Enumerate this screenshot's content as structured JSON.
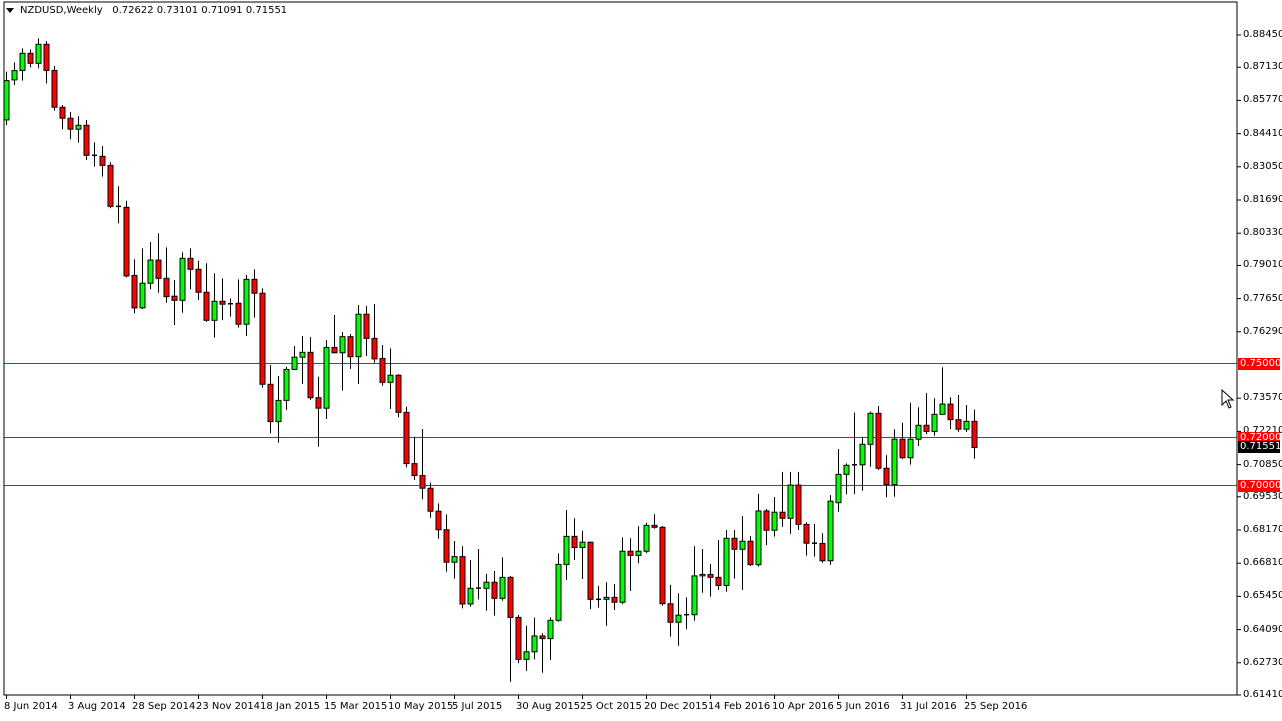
{
  "header": {
    "symbol": "NZDUSD,Weekly",
    "ohlc": "0.72622 0.73101 0.71091 0.71551"
  },
  "colors": {
    "bull": "#00ff00",
    "bear": "#ff0000",
    "level_line": "#ff0000",
    "current_badge": "#000000",
    "outline": "#000000"
  },
  "chart_data": {
    "type": "candlestick",
    "title": "NZDUSD,Weekly",
    "ylim": [
      0.6141,
      0.8845
    ],
    "y_ticks": [
      "0.88450",
      "0.87130",
      "0.85770",
      "0.84410",
      "0.83050",
      "0.81690",
      "0.80330",
      "0.79010",
      "0.77650",
      "0.76290",
      "0.73570",
      "0.72210",
      "0.70850",
      "0.69530",
      "0.68170",
      "0.66810",
      "0.65450",
      "0.64090",
      "0.62730",
      "0.61410"
    ],
    "x_labels": [
      "8 Jun 2014",
      "3 Aug 2014",
      "28 Sep 2014",
      "23 Nov 2014",
      "18 Jan 2015",
      "15 Mar 2015",
      "10 May 2015",
      "5 Jul 2015",
      "30 Aug 2015",
      "25 Oct 2015",
      "20 Dec 2015",
      "14 Feb 2016",
      "10 Apr 2016",
      "5 Jun 2016",
      "31 Jul 2016",
      "25 Sep 2016"
    ],
    "x_label_every": 8,
    "levels": [
      {
        "price": 0.75,
        "label": "0.75000"
      },
      {
        "price": 0.72,
        "label": "0.72000"
      },
      {
        "price": 0.7,
        "label": "0.70000"
      }
    ],
    "current": {
      "price": 0.71551,
      "label": "0.71551"
    },
    "candles_ohlc": [
      [
        0.8497,
        0.8695,
        0.8476,
        0.8658
      ],
      [
        0.8661,
        0.8733,
        0.864,
        0.8699
      ],
      [
        0.87,
        0.879,
        0.8658,
        0.877
      ],
      [
        0.877,
        0.8786,
        0.8713,
        0.8729
      ],
      [
        0.8729,
        0.8831,
        0.8709,
        0.8807
      ],
      [
        0.8807,
        0.882,
        0.8647,
        0.87
      ],
      [
        0.87,
        0.8718,
        0.8535,
        0.8549
      ],
      [
        0.8549,
        0.8558,
        0.8459,
        0.8504
      ],
      [
        0.8504,
        0.853,
        0.8418,
        0.8459
      ],
      [
        0.8459,
        0.8513,
        0.8404,
        0.8475
      ],
      [
        0.8475,
        0.8497,
        0.8333,
        0.8352
      ],
      [
        0.8352,
        0.8405,
        0.8305,
        0.8349
      ],
      [
        0.8348,
        0.839,
        0.8265,
        0.8311
      ],
      [
        0.8311,
        0.8324,
        0.8135,
        0.8143
      ],
      [
        0.8143,
        0.8226,
        0.8074,
        0.8142
      ],
      [
        0.8139,
        0.8166,
        0.7852,
        0.7858
      ],
      [
        0.786,
        0.7926,
        0.7705,
        0.7727
      ],
      [
        0.7727,
        0.7971,
        0.7722,
        0.7828
      ],
      [
        0.7828,
        0.7997,
        0.7803,
        0.7923
      ],
      [
        0.7923,
        0.8033,
        0.7789,
        0.7848
      ],
      [
        0.7848,
        0.7975,
        0.7748,
        0.7773
      ],
      [
        0.7775,
        0.7841,
        0.7657,
        0.7758
      ],
      [
        0.7758,
        0.7955,
        0.7707,
        0.793
      ],
      [
        0.793,
        0.7971,
        0.7803,
        0.7885
      ],
      [
        0.7885,
        0.792,
        0.7759,
        0.7791
      ],
      [
        0.7791,
        0.791,
        0.767,
        0.7676
      ],
      [
        0.7676,
        0.7869,
        0.7605,
        0.7754
      ],
      [
        0.7754,
        0.7848,
        0.7677,
        0.7742
      ],
      [
        0.7743,
        0.7766,
        0.7691,
        0.7744
      ],
      [
        0.7746,
        0.7844,
        0.7646,
        0.766
      ],
      [
        0.766,
        0.7862,
        0.7612,
        0.7844
      ],
      [
        0.7844,
        0.7885,
        0.7687,
        0.7787
      ],
      [
        0.7787,
        0.7807,
        0.74,
        0.7414
      ],
      [
        0.7414,
        0.7493,
        0.7213,
        0.7261
      ],
      [
        0.7261,
        0.7448,
        0.7175,
        0.7348
      ],
      [
        0.7348,
        0.7486,
        0.7309,
        0.7475
      ],
      [
        0.7475,
        0.7571,
        0.7473,
        0.7525
      ],
      [
        0.7525,
        0.7612,
        0.7415,
        0.7545
      ],
      [
        0.7545,
        0.7607,
        0.735,
        0.7359
      ],
      [
        0.7359,
        0.7445,
        0.7158,
        0.7316
      ],
      [
        0.7316,
        0.7595,
        0.7272,
        0.7565
      ],
      [
        0.7565,
        0.7698,
        0.7541,
        0.7543
      ],
      [
        0.7543,
        0.7628,
        0.7388,
        0.7609
      ],
      [
        0.7609,
        0.762,
        0.7477,
        0.7527
      ],
      [
        0.7527,
        0.7739,
        0.7415,
        0.7701
      ],
      [
        0.7701,
        0.7735,
        0.753,
        0.7602
      ],
      [
        0.7602,
        0.7743,
        0.7502,
        0.7518
      ],
      [
        0.752,
        0.7575,
        0.7408,
        0.7422
      ],
      [
        0.7422,
        0.7561,
        0.7313,
        0.7451
      ],
      [
        0.7451,
        0.7455,
        0.7279,
        0.7299
      ],
      [
        0.7299,
        0.7322,
        0.7074,
        0.7089
      ],
      [
        0.7089,
        0.7199,
        0.7022,
        0.704
      ],
      [
        0.704,
        0.7231,
        0.6943,
        0.6988
      ],
      [
        0.6988,
        0.7011,
        0.6867,
        0.6894
      ],
      [
        0.6894,
        0.6926,
        0.6781,
        0.6818
      ],
      [
        0.6818,
        0.6881,
        0.6646,
        0.6685
      ],
      [
        0.6685,
        0.6772,
        0.6618,
        0.6708
      ],
      [
        0.6708,
        0.6751,
        0.6496,
        0.6514
      ],
      [
        0.6514,
        0.6694,
        0.6503,
        0.6578
      ],
      [
        0.6578,
        0.6739,
        0.6533,
        0.6579
      ],
      [
        0.6578,
        0.6637,
        0.6486,
        0.6603
      ],
      [
        0.6603,
        0.6649,
        0.6466,
        0.6537
      ],
      [
        0.6537,
        0.6705,
        0.6527,
        0.6623
      ],
      [
        0.6623,
        0.6629,
        0.6195,
        0.6459
      ],
      [
        0.6459,
        0.6469,
        0.6271,
        0.6287
      ],
      [
        0.6287,
        0.6425,
        0.624,
        0.6318
      ],
      [
        0.6318,
        0.6458,
        0.6287,
        0.6383
      ],
      [
        0.6383,
        0.6394,
        0.6232,
        0.6372
      ],
      [
        0.6372,
        0.6459,
        0.6284,
        0.6447
      ],
      [
        0.6447,
        0.6721,
        0.6441,
        0.6676
      ],
      [
        0.6676,
        0.6899,
        0.6612,
        0.6791
      ],
      [
        0.6791,
        0.6865,
        0.6694,
        0.6745
      ],
      [
        0.6745,
        0.6814,
        0.6616,
        0.6767
      ],
      [
        0.6767,
        0.6769,
        0.6493,
        0.6533
      ],
      [
        0.6533,
        0.6588,
        0.6499,
        0.6532
      ],
      [
        0.6533,
        0.6603,
        0.6424,
        0.6541
      ],
      [
        0.6541,
        0.6595,
        0.6489,
        0.6521
      ],
      [
        0.6521,
        0.6787,
        0.6513,
        0.673
      ],
      [
        0.673,
        0.6783,
        0.6567,
        0.6713
      ],
      [
        0.6713,
        0.6833,
        0.6681,
        0.673
      ],
      [
        0.673,
        0.6847,
        0.6722,
        0.6836
      ],
      [
        0.6836,
        0.6882,
        0.6822,
        0.6828
      ],
      [
        0.6828,
        0.6834,
        0.6507,
        0.6515
      ],
      [
        0.6515,
        0.6592,
        0.638,
        0.6439
      ],
      [
        0.6439,
        0.6558,
        0.6343,
        0.6468
      ],
      [
        0.6468,
        0.6541,
        0.6411,
        0.647
      ],
      [
        0.647,
        0.6751,
        0.6445,
        0.6629
      ],
      [
        0.6629,
        0.6739,
        0.656,
        0.6635
      ],
      [
        0.6635,
        0.6678,
        0.6544,
        0.6623
      ],
      [
        0.6623,
        0.6776,
        0.6572,
        0.659
      ],
      [
        0.659,
        0.6817,
        0.6564,
        0.6783
      ],
      [
        0.6783,
        0.6817,
        0.6618,
        0.6738
      ],
      [
        0.6738,
        0.6874,
        0.6571,
        0.6771
      ],
      [
        0.6771,
        0.6792,
        0.667,
        0.6675
      ],
      [
        0.6675,
        0.6965,
        0.6667,
        0.6895
      ],
      [
        0.6895,
        0.6903,
        0.6755,
        0.6816
      ],
      [
        0.6816,
        0.6952,
        0.679,
        0.689
      ],
      [
        0.689,
        0.7055,
        0.683,
        0.6865
      ],
      [
        0.6865,
        0.7055,
        0.6801,
        0.7001
      ],
      [
        0.7001,
        0.7055,
        0.6817,
        0.684
      ],
      [
        0.684,
        0.6849,
        0.6712,
        0.6763
      ],
      [
        0.6763,
        0.6842,
        0.6708,
        0.6762
      ],
      [
        0.6762,
        0.6804,
        0.6683,
        0.6691
      ],
      [
        0.6691,
        0.696,
        0.6674,
        0.6935
      ],
      [
        0.6929,
        0.7149,
        0.6892,
        0.7045
      ],
      [
        0.7045,
        0.709,
        0.6963,
        0.7082
      ],
      [
        0.7082,
        0.7298,
        0.6964,
        0.7084
      ],
      [
        0.7084,
        0.7199,
        0.6978,
        0.7168
      ],
      [
        0.7168,
        0.7302,
        0.7076,
        0.7295
      ],
      [
        0.7295,
        0.7325,
        0.7063,
        0.707
      ],
      [
        0.707,
        0.7124,
        0.6951,
        0.7003
      ],
      [
        0.7003,
        0.723,
        0.6953,
        0.7189
      ],
      [
        0.7189,
        0.7257,
        0.7108,
        0.7113
      ],
      [
        0.7113,
        0.7338,
        0.7085,
        0.7189
      ],
      [
        0.7189,
        0.732,
        0.7161,
        0.7246
      ],
      [
        0.7246,
        0.7378,
        0.721,
        0.7221
      ],
      [
        0.7221,
        0.7357,
        0.7203,
        0.7291
      ],
      [
        0.7291,
        0.7484,
        0.7291,
        0.7333
      ],
      [
        0.7333,
        0.7361,
        0.7231,
        0.7269
      ],
      [
        0.7269,
        0.737,
        0.7219,
        0.723
      ],
      [
        0.723,
        0.7329,
        0.7219,
        0.7262
      ],
      [
        0.72622,
        0.73101,
        0.71091,
        0.71551
      ]
    ]
  }
}
